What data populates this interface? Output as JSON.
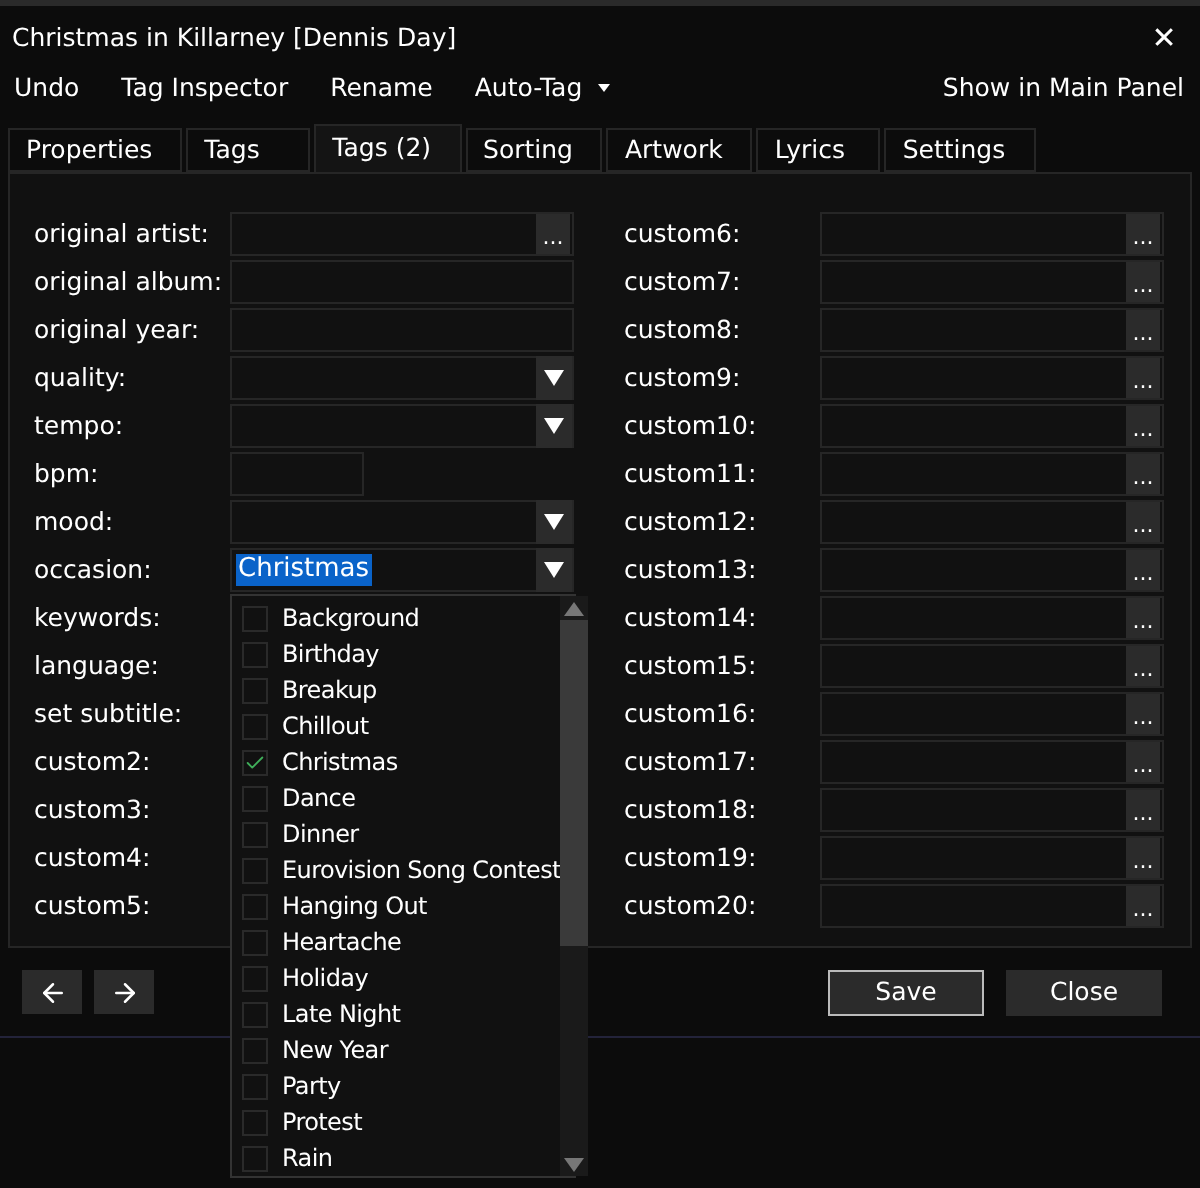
{
  "window": {
    "title": "Christmas in Killarney [Dennis Day]",
    "close": "✕"
  },
  "toolbar": {
    "items": [
      {
        "label": "Undo",
        "kind": "button"
      },
      {
        "label": "Tag Inspector",
        "kind": "button"
      },
      {
        "label": "Rename",
        "kind": "button"
      },
      {
        "label": "Auto-Tag",
        "kind": "menu"
      }
    ],
    "right": "Show in Main Panel"
  },
  "tabs": [
    {
      "label": "Properties",
      "selected": false
    },
    {
      "label": "Tags",
      "selected": false
    },
    {
      "label": "Tags (2)",
      "selected": true
    },
    {
      "label": "Sorting",
      "selected": false
    },
    {
      "label": "Artwork",
      "selected": false
    },
    {
      "label": "Lyrics",
      "selected": false
    },
    {
      "label": "Settings",
      "selected": false
    }
  ],
  "left_fields": [
    {
      "label": "original artist:",
      "kind": "browse"
    },
    {
      "label": "original album:",
      "kind": "text"
    },
    {
      "label": "original year:",
      "kind": "text"
    },
    {
      "label": "quality:",
      "kind": "dropdown"
    },
    {
      "label": "tempo:",
      "kind": "dropdown"
    },
    {
      "label": "bpm:",
      "kind": "short"
    },
    {
      "label": "mood:",
      "kind": "dropdown"
    },
    {
      "label": "occasion:",
      "kind": "dropdown",
      "value": "Christmas"
    },
    {
      "label": "keywords:",
      "kind": "covered"
    },
    {
      "label": "language:",
      "kind": "covered"
    },
    {
      "label": "set subtitle:",
      "kind": "covered"
    },
    {
      "label": "custom2:",
      "kind": "covered"
    },
    {
      "label": "custom3:",
      "kind": "covered"
    },
    {
      "label": "custom4:",
      "kind": "covered"
    },
    {
      "label": "custom5:",
      "kind": "covered"
    }
  ],
  "right_fields": [
    {
      "label": "custom6:"
    },
    {
      "label": "custom7:"
    },
    {
      "label": "custom8:"
    },
    {
      "label": "custom9:"
    },
    {
      "label": "custom10:"
    },
    {
      "label": "custom11:"
    },
    {
      "label": "custom12:"
    },
    {
      "label": "custom13:"
    },
    {
      "label": "custom14:"
    },
    {
      "label": "custom15:"
    },
    {
      "label": "custom16:"
    },
    {
      "label": "custom17:"
    },
    {
      "label": "custom18:"
    },
    {
      "label": "custom19:"
    },
    {
      "label": "custom20:"
    }
  ],
  "browse_button": "...",
  "occasion_list": {
    "items": [
      {
        "label": "Background",
        "checked": false
      },
      {
        "label": "Birthday",
        "checked": false
      },
      {
        "label": "Breakup",
        "checked": false
      },
      {
        "label": "Chillout",
        "checked": false
      },
      {
        "label": "Christmas",
        "checked": true
      },
      {
        "label": "Dance",
        "checked": false
      },
      {
        "label": "Dinner",
        "checked": false
      },
      {
        "label": "Eurovision Song Contest",
        "checked": false
      },
      {
        "label": "Hanging Out",
        "checked": false
      },
      {
        "label": "Heartache",
        "checked": false
      },
      {
        "label": "Holiday",
        "checked": false
      },
      {
        "label": "Late Night",
        "checked": false
      },
      {
        "label": "New Year",
        "checked": false
      },
      {
        "label": "Party",
        "checked": false
      },
      {
        "label": "Protest",
        "checked": false
      },
      {
        "label": "Rain",
        "checked": false
      }
    ]
  },
  "footer": {
    "buttons": [
      {
        "label": "Save",
        "selected": true
      },
      {
        "label": "Close",
        "selected": false
      }
    ]
  }
}
